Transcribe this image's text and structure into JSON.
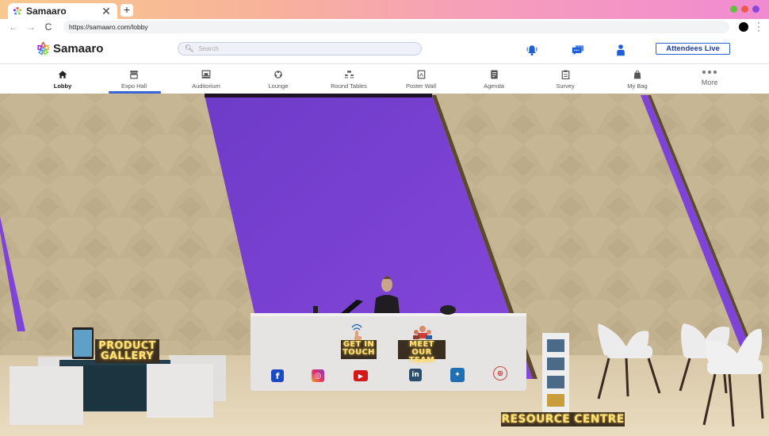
{
  "browser": {
    "tab_title": "Samaaro",
    "tab_close": "✕",
    "new_tab": "+",
    "url": "https://samaaro.com/lobby",
    "back": "←",
    "forward": "→",
    "reload": "C",
    "window_dots": [
      "#5fc13a",
      "#ee5a4a",
      "#8a48d8"
    ]
  },
  "header": {
    "brand": "Samaaro",
    "search_placeholder": "Search",
    "attendees_live_label": "Attendees Live",
    "icons": [
      "notification-bell-icon",
      "chat-icon",
      "profile-icon"
    ],
    "accent": "#1f5fd6"
  },
  "nav": {
    "items": [
      {
        "label": "Lobby",
        "icon": "home-icon",
        "active": true
      },
      {
        "label": "Expo Hall",
        "icon": "booth-icon",
        "active": false
      },
      {
        "label": "Auditorium",
        "icon": "stage-icon",
        "active": false
      },
      {
        "label": "Lounge",
        "icon": "lounge-icon",
        "active": false
      },
      {
        "label": "Round Tables",
        "icon": "round-table-icon",
        "active": false
      },
      {
        "label": "Poster Wall",
        "icon": "poster-icon",
        "active": false
      },
      {
        "label": "Agenda",
        "icon": "agenda-icon",
        "active": false
      },
      {
        "label": "Survey",
        "icon": "survey-icon",
        "active": false
      },
      {
        "label": "My Bag",
        "icon": "bag-icon",
        "active": false
      },
      {
        "label": "More",
        "icon": "more-dots-icon",
        "active": false
      }
    ],
    "hovered": "Expo Hall"
  },
  "scene": {
    "product_gallery": [
      "PRODUCT",
      "GALLERY"
    ],
    "get_in_touch": [
      "GET IN",
      "TOUCH"
    ],
    "meet_our_team": [
      "MEET OUR",
      "TEAM"
    ],
    "resource_centre": "RESOURCE CENTRE",
    "socials": [
      {
        "name": "facebook",
        "glyph": "f",
        "color": "#1a4bc4"
      },
      {
        "name": "instagram",
        "glyph": "◎",
        "color": "#e1306c"
      },
      {
        "name": "youtube",
        "glyph": "▶",
        "color": "#d41818"
      },
      {
        "name": "linkedin",
        "glyph": "in",
        "color": "#2b4d6e"
      },
      {
        "name": "twitter",
        "glyph": "🐦",
        "color": "#1f6fb2"
      },
      {
        "name": "website",
        "glyph": "🌐",
        "color": "#c33"
      }
    ],
    "wall_purple": "#7a3fd6",
    "wall_wood": "#bfae8c"
  }
}
